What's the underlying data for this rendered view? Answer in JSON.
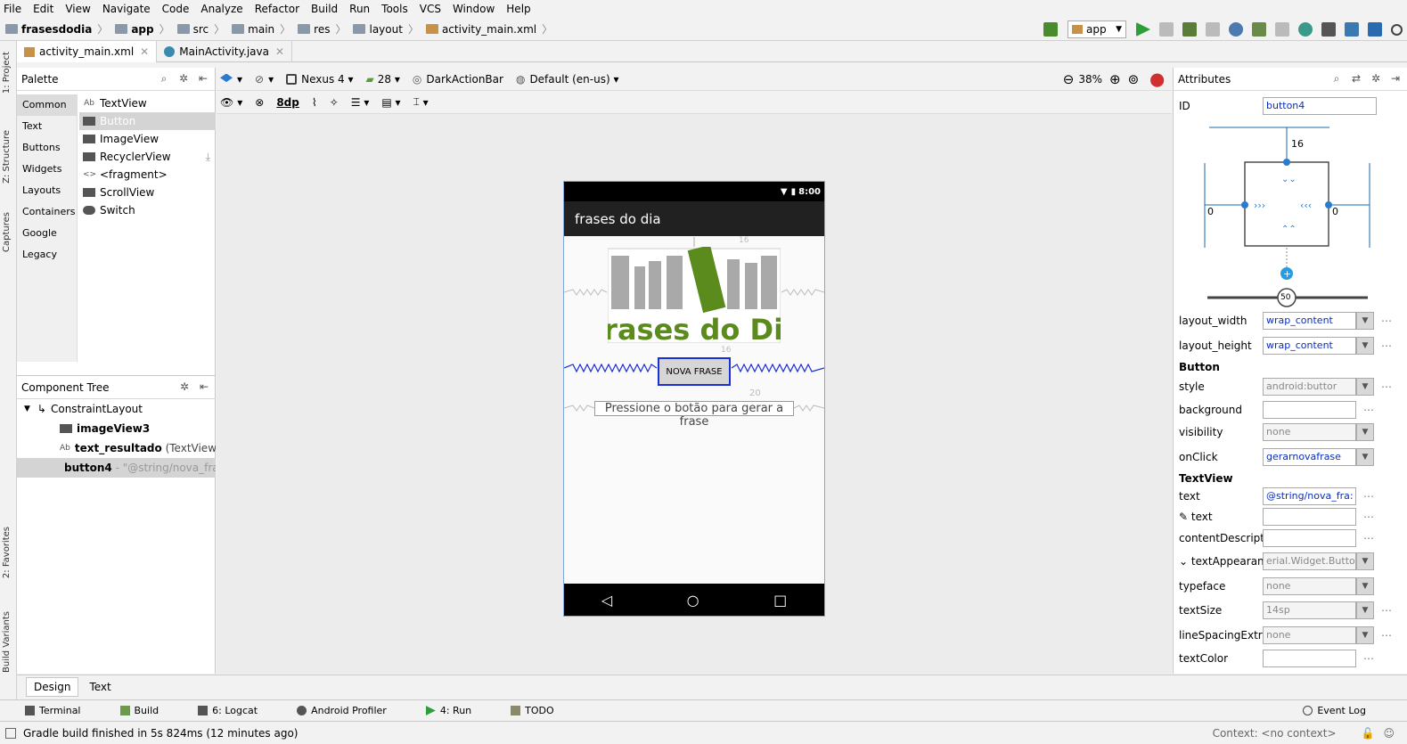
{
  "menu": [
    "File",
    "Edit",
    "View",
    "Navigate",
    "Code",
    "Analyze",
    "Refactor",
    "Build",
    "Run",
    "Tools",
    "VCS",
    "Window",
    "Help"
  ],
  "breadcrumbs": [
    "frasesdodia",
    "app",
    "src",
    "main",
    "res",
    "layout",
    "activity_main.xml"
  ],
  "run_config": "app",
  "editor_tabs": [
    "activity_main.xml",
    "MainActivity.java"
  ],
  "left_strip": [
    "1: Project",
    "Z: Structure",
    "Captures",
    "2: Favorites",
    "Build Variants"
  ],
  "palette": {
    "title": "Palette",
    "categories": [
      "Common",
      "Text",
      "Buttons",
      "Widgets",
      "Layouts",
      "Containers",
      "Google",
      "Legacy"
    ],
    "items": [
      "TextView",
      "Button",
      "ImageView",
      "RecyclerView",
      "<fragment>",
      "ScrollView",
      "Switch"
    ]
  },
  "tree": {
    "title": "Component Tree",
    "nodes": [
      {
        "name": "ConstraintLayout",
        "detail": ""
      },
      {
        "name": "imageView3",
        "detail": ""
      },
      {
        "name": "text_resultado",
        "detail": "(TextView) - \"("
      },
      {
        "name": "button4",
        "detail": "- \"@string/nova_fras"
      }
    ]
  },
  "canvas_toolbar": {
    "device": "Nexus 4",
    "api": "28",
    "theme": "DarkActionBar",
    "locale": "Default (en-us)",
    "zoom": "38%",
    "margin": "8dp"
  },
  "phone": {
    "time": "8:00",
    "app_title": "frases do dia",
    "logo_text": "Frases do Dia",
    "button_text": "NOVA FRASE",
    "result_text": "Pressione o botão para gerar a frase",
    "margin_top": "16",
    "margin_btn": "16",
    "margin_text": "20"
  },
  "attributes": {
    "title": "Attributes",
    "id_label": "ID",
    "id_value": "button4",
    "constraint_top": "16",
    "constraint_left": "0",
    "constraint_right": "0",
    "bias": "50",
    "layout_width": {
      "label": "layout_width",
      "value": "wrap_content"
    },
    "layout_height": {
      "label": "layout_height",
      "value": "wrap_content"
    },
    "section_button": "Button",
    "style": {
      "label": "style",
      "value": "android:buttor"
    },
    "background": {
      "label": "background",
      "value": ""
    },
    "visibility": {
      "label": "visibility",
      "value": "none"
    },
    "onclick": {
      "label": "onClick",
      "value": "gerarnovafrase"
    },
    "section_textview": "TextView",
    "text": {
      "label": "text",
      "value": "@string/nova_fra:"
    },
    "text2": {
      "label": "text",
      "value": ""
    },
    "contentdesc": {
      "label": "contentDescripti",
      "value": ""
    },
    "textappearance": {
      "label": "textAppearanc",
      "value": "erial.Widget.Button"
    },
    "typeface": {
      "label": "typeface",
      "value": "none"
    },
    "textsize": {
      "label": "textSize",
      "value": "14sp"
    },
    "linespacing": {
      "label": "lineSpacingExtra",
      "value": "none"
    },
    "textcolor": {
      "label": "textColor",
      "value": ""
    }
  },
  "design_tabs": [
    "Design",
    "Text"
  ],
  "tool_windows": [
    "Terminal",
    "Build",
    "6: Logcat",
    "Android Profiler",
    "4: Run",
    "TODO"
  ],
  "event_log": "Event Log",
  "status_message": "Gradle build finished in 5s 824ms (12 minutes ago)",
  "context": "Context: <no context>",
  "colors": {
    "accent": "#1a2fd6",
    "logo_green": "#5b8a1d",
    "logo_gray": "#a9a9a9"
  }
}
